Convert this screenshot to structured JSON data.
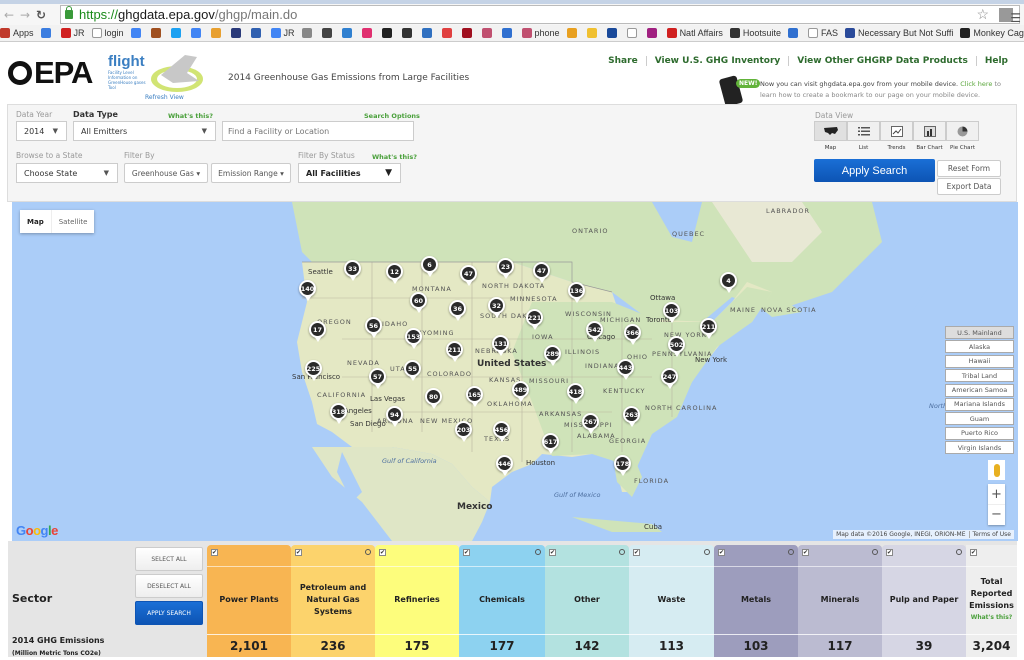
{
  "browser": {
    "url_https": "https://",
    "url_host": "ghgdata.epa.gov",
    "url_path": "/ghgp/main.do",
    "bookmarks": [
      {
        "label": "Apps",
        "color": "#c0392b"
      },
      {
        "label": "",
        "color": "#3b7de0"
      },
      {
        "label": "JR",
        "color": "#d02020"
      },
      {
        "label": "login",
        "color": "#ffffff"
      },
      {
        "label": "",
        "color": "#4285f4"
      },
      {
        "label": "",
        "color": "#a05020"
      },
      {
        "label": "",
        "color": "#1da1f2"
      },
      {
        "label": "",
        "color": "#4285f4"
      },
      {
        "label": "",
        "color": "#e8a030"
      },
      {
        "label": "",
        "color": "#2a3a7a"
      },
      {
        "label": "",
        "color": "#3060b0"
      },
      {
        "label": "JR",
        "color": "#4285f4"
      },
      {
        "label": "",
        "color": "#888888"
      },
      {
        "label": "",
        "color": "#444444"
      },
      {
        "label": "",
        "color": "#3080d0"
      },
      {
        "label": "",
        "color": "#e03070"
      },
      {
        "label": "",
        "color": "#222222"
      },
      {
        "label": "",
        "color": "#333333"
      },
      {
        "label": "",
        "color": "#3070c0"
      },
      {
        "label": "",
        "color": "#e04040"
      },
      {
        "label": "",
        "color": "#a01020"
      },
      {
        "label": "",
        "color": "#c05070"
      },
      {
        "label": "",
        "color": "#3070d0"
      },
      {
        "label": "phone",
        "color": "#c05070"
      },
      {
        "label": "",
        "color": "#e8a020"
      },
      {
        "label": "",
        "color": "#f0c030"
      },
      {
        "label": "",
        "color": "#1a4a9a"
      },
      {
        "label": "",
        "color": "#ffffff"
      },
      {
        "label": "",
        "color": "#a02080"
      },
      {
        "label": "Natl Affairs",
        "color": "#d02020"
      },
      {
        "label": "Hootsuite",
        "color": "#333333"
      },
      {
        "label": "",
        "color": "#3070d0"
      },
      {
        "label": "FAS",
        "color": "#ffffff"
      },
      {
        "label": "Necessary But Not Suffi",
        "color": "#2a4a9a"
      },
      {
        "label": "Monkey Cage - The Wa",
        "color": "#222222"
      }
    ]
  },
  "header": {
    "epa_logo_text": "EPA",
    "flight_logo_text": "flight",
    "flight_subtitle": "Facility Level Information on GreenHouse gases Tool",
    "refresh_view": "Refresh View",
    "page_title": "2014 Greenhouse Gas Emissions from Large Facilities",
    "links": [
      "Share",
      "View U.S. GHG Inventory",
      "View Other GHGRP Data Products",
      "Help"
    ],
    "mobile_badge": "NEW!",
    "mobile_note_1": "Now you can visit ghgdata.epa.gov from your mobile device.",
    "mobile_note_link": "Click here",
    "mobile_note_2": "to",
    "mobile_note_3": "learn how to create a bookmark to our page on your mobile device."
  },
  "search": {
    "data_year_label": "Data Year",
    "data_year_value": "2014",
    "data_type_label": "Data Type",
    "whats_this": "What's this?",
    "data_type_value": "All Emitters",
    "search_options": "Search Options",
    "find_placeholder": "Find a Facility or Location",
    "browse_state_label": "Browse to a State",
    "state_value": "Choose State",
    "filter_by_label": "Filter By",
    "greenhouse_gas": "Greenhouse Gas",
    "emission_range": "Emission Range",
    "filter_status_label": "Filter By Status",
    "status_value": "All Facilities",
    "data_view_label": "Data View",
    "data_views": [
      "Map",
      "List",
      "Trends",
      "Bar Chart",
      "Pie Chart"
    ],
    "active_view": "Map",
    "apply_search": "Apply Search",
    "reset_form": "Reset Form",
    "export_data": "Export Data"
  },
  "map": {
    "type_map": "Map",
    "type_satellite": "Satellite",
    "regions": [
      "U.S. Mainland",
      "Alaska",
      "Hawaii",
      "Tribal Land",
      "American Samoa",
      "Mariana Islands",
      "Guam",
      "Puerto Rico",
      "Virgin Islands"
    ],
    "active_region": "U.S. Mainland",
    "zoom_in": "+",
    "zoom_out": "−",
    "attribution": "Map data ©2016 Google, INEGI, ORION-ME",
    "terms": "Terms of Use",
    "google": "Google",
    "markers": [
      "140",
      "33",
      "12",
      "6",
      "47",
      "23",
      "47",
      "136",
      "4",
      "60",
      "36",
      "32",
      "221",
      "17",
      "56",
      "153",
      "211",
      "131",
      "542",
      "366",
      "103",
      "211",
      "502",
      "225",
      "57",
      "55",
      "289",
      "443",
      "247",
      "489",
      "418",
      "165",
      "80",
      "318",
      "94",
      "263",
      "267",
      "203",
      "456",
      "617",
      "446",
      "178"
    ],
    "labels": [
      "Seattle",
      "OREGON",
      "NEVADA",
      "CALIFORNIA",
      "San Francisco",
      "Los Angeles",
      "San Diego",
      "Las Vegas",
      "UTAH",
      "WYOMING",
      "COLORADO",
      "NEW MEXICO",
      "TEXAS",
      "Houston",
      "KANSAS",
      "NEBRASKA",
      "IOWA",
      "MINNESOTA",
      "WISCONSIN",
      "MICHIGAN",
      "Chicago",
      "ILLINOIS",
      "INDIANA",
      "OHIO",
      "KENTUCKY",
      "MISSOURI",
      "OKLAHOMA",
      "ARKANSAS",
      "MISSISSIPPI",
      "ALABAMA",
      "GEORGIA",
      "NORTH CAROLINA",
      "NEW YORK",
      "New York",
      "Toronto",
      "Ottawa",
      "MAINE",
      "NOVA SCOTIA",
      "ONTARIO",
      "QUEBEC",
      "LABRADOR",
      "United States",
      "Mexico",
      "Gulf of Mexico",
      "Gulf of California",
      "Cuba",
      "North Atlantic Ocean",
      "MONTANA",
      "SOUTH DAKOTA",
      "NORTH DAKOTA",
      "IDAHO",
      "ARIZONA",
      "PENNSYLVANIA",
      "FLORIDA"
    ]
  },
  "sector": {
    "label": "Sector",
    "select_all": "SELECT ALL",
    "deselect_all": "DESELECT ALL",
    "apply_search": "APPLY SEARCH",
    "emissions_label": "2014 GHG Emissions",
    "emissions_units": "(Million Metric Tons CO2e)",
    "whats_this": "What's this?",
    "columns": [
      {
        "name": "Power Plants",
        "value": "2,101",
        "color": "#f8b552",
        "info": false
      },
      {
        "name": "Petroleum and Natural Gas Systems",
        "value": "236",
        "color": "#fcd36c",
        "info": true
      },
      {
        "name": "Refineries",
        "value": "175",
        "color": "#fdfd7c",
        "info": false
      },
      {
        "name": "Chemicals",
        "value": "177",
        "color": "#8dd2f0",
        "info": true
      },
      {
        "name": "Other",
        "value": "142",
        "color": "#b3e2e0",
        "info": true
      },
      {
        "name": "Waste",
        "value": "113",
        "color": "#d6ecf2",
        "info": true
      },
      {
        "name": "Metals",
        "value": "103",
        "color": "#9d9dbd",
        "info": true
      },
      {
        "name": "Minerals",
        "value": "117",
        "color": "#bbbbd1",
        "info": true
      },
      {
        "name": "Pulp and Paper",
        "value": "39",
        "color": "#d6d6e4",
        "info": true
      },
      {
        "name": "Total Reported Emissions",
        "value": "3,204",
        "color": "#eeeeee",
        "info": false
      }
    ]
  }
}
